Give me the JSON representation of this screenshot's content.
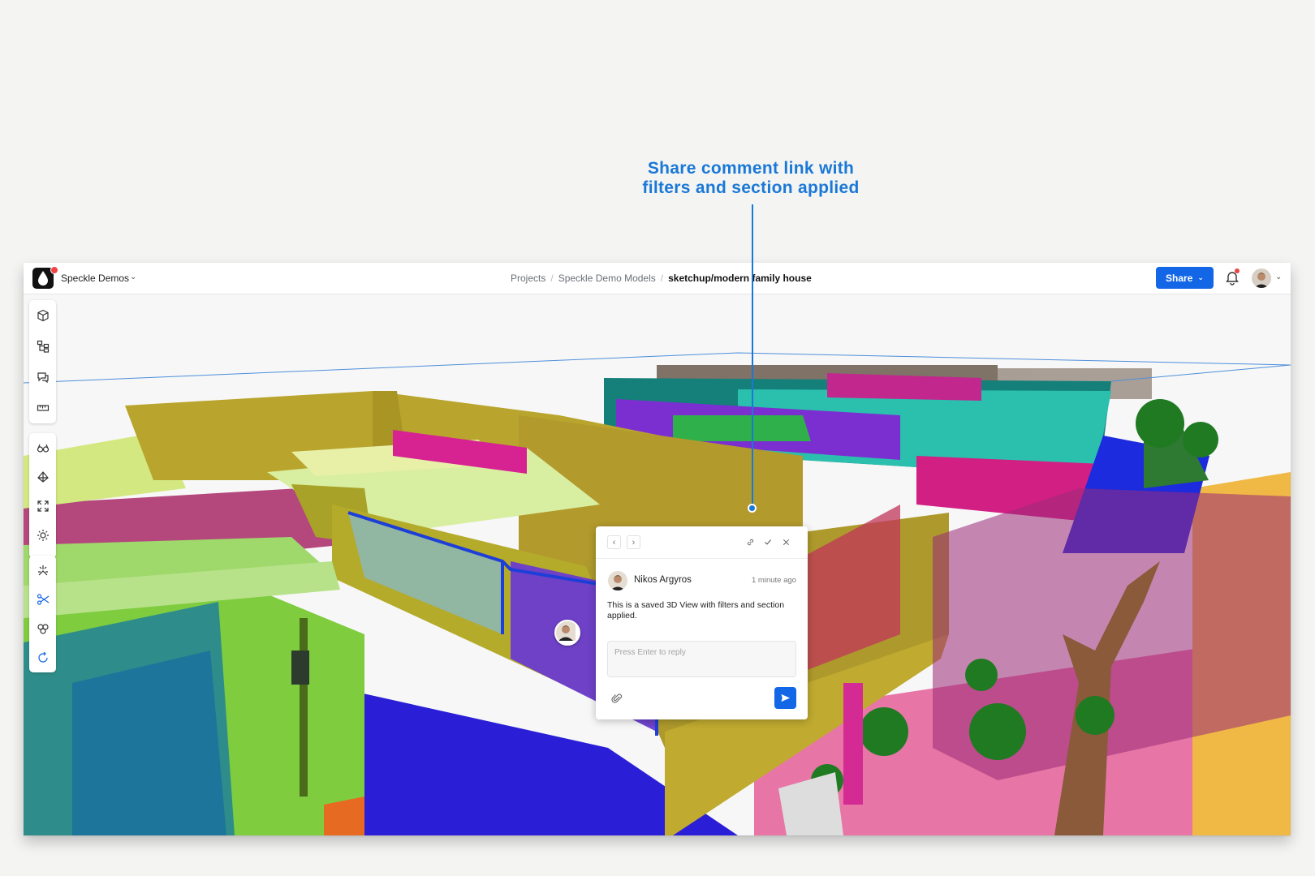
{
  "annotation": {
    "line1": "Share comment link with",
    "line2": "filters and section applied"
  },
  "header": {
    "workspace": "Speckle Demos",
    "breadcrumbs": [
      "Projects",
      "Speckle Demo Models",
      "sketchup/modern family house"
    ],
    "share_label": "Share"
  },
  "toolbar": {
    "group1": [
      "models-icon",
      "scene-explorer-icon",
      "discussions-icon",
      "measure-icon"
    ],
    "group2": [
      "view-modes-icon",
      "camera-views-icon",
      "zoom-extents-icon",
      "lighting-icon"
    ],
    "group3": [
      "explode-icon",
      "section-box-icon",
      "filters-icon",
      "reset-icon"
    ]
  },
  "comment": {
    "author": "Nikos Argyros",
    "time": "1 minute ago",
    "text": "This is a saved 3D View with filters and section applied.",
    "reply_placeholder": "Press Enter to reply"
  },
  "colors": {
    "accent": "#1366e6",
    "annotation": "#1a78d6",
    "notification": "#ef4444"
  }
}
